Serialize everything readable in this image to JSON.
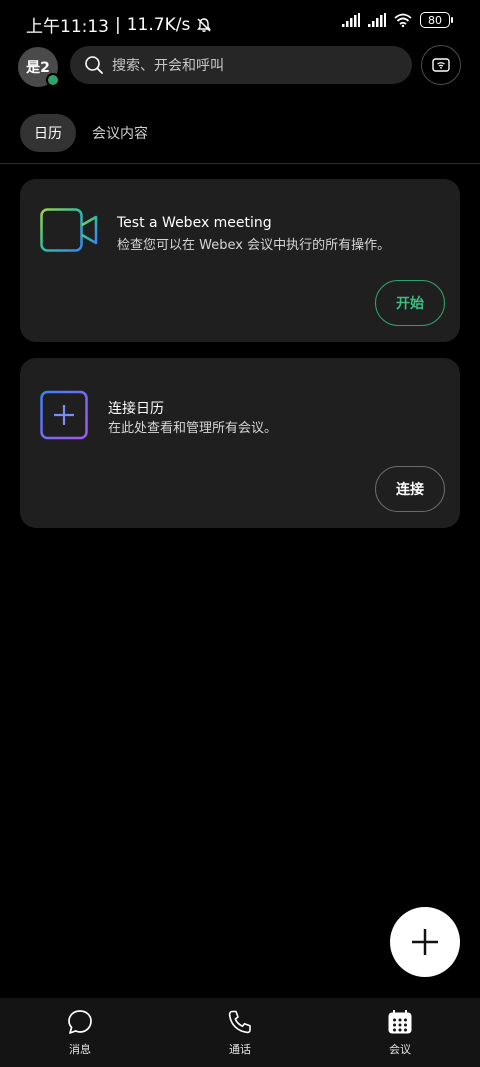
{
  "status_bar": {
    "time": "上午11:13",
    "separator": "|",
    "net_speed": "11.7K/s",
    "battery": "80"
  },
  "header": {
    "avatar_text": "是2",
    "search_placeholder": "搜索、开会和呼叫"
  },
  "tabs": [
    {
      "label": "日历",
      "active": true
    },
    {
      "label": "会议内容",
      "active": false
    }
  ],
  "cards": {
    "test_meeting": {
      "title": "Test a Webex meeting",
      "description": "检查您可以在 Webex 会议中执行的所有操作。",
      "button": "开始"
    },
    "connect_calendar": {
      "title": "连接日历",
      "description": "在此处查看和管理所有会议。",
      "button": "连接"
    }
  },
  "bottom_nav": [
    {
      "label": "消息",
      "icon": "chat-bubble-icon"
    },
    {
      "label": "通话",
      "icon": "phone-icon"
    },
    {
      "label": "会议",
      "icon": "calendar-icon",
      "active": true
    }
  ],
  "colors": {
    "accent_green": "#2fa36b",
    "background": "#000000",
    "card": "#1f1f1f"
  }
}
